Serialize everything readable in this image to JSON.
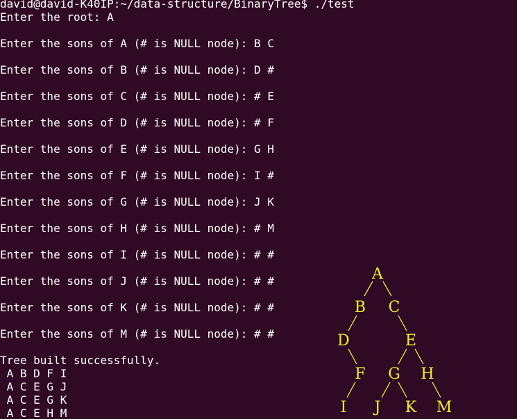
{
  "terminal": {
    "lines": [
      "david@david-K40IP:~/data-structure/BinaryTree$ ./test",
      "Enter the root: A",
      "",
      "Enter the sons of A (# is NULL node): B C",
      "",
      "Enter the sons of B (# is NULL node): D #",
      "",
      "Enter the sons of C (# is NULL node): # E",
      "",
      "Enter the sons of D (# is NULL node): # F",
      "",
      "Enter the sons of E (# is NULL node): G H",
      "",
      "Enter the sons of F (# is NULL node): I #",
      "",
      "Enter the sons of G (# is NULL node): J K",
      "",
      "Enter the sons of H (# is NULL node): # M",
      "",
      "Enter the sons of I (# is NULL node): # #",
      "",
      "Enter the sons of J (# is NULL node): # #",
      "",
      "Enter the sons of K (# is NULL node): # #",
      "",
      "Enter the sons of M (# is NULL node): # #",
      "",
      "Tree built successfully.",
      " A B D F I",
      " A C E G J",
      " A C E G K",
      " A C E H M"
    ]
  },
  "tree": {
    "color": "#f0ef2b",
    "nodes": [
      "A",
      "B",
      "C",
      "D",
      "E",
      "F",
      "G",
      "H",
      "I",
      "J",
      "K",
      "M"
    ]
  },
  "colors": {
    "background": "#300a24",
    "text": "#ffffff"
  }
}
